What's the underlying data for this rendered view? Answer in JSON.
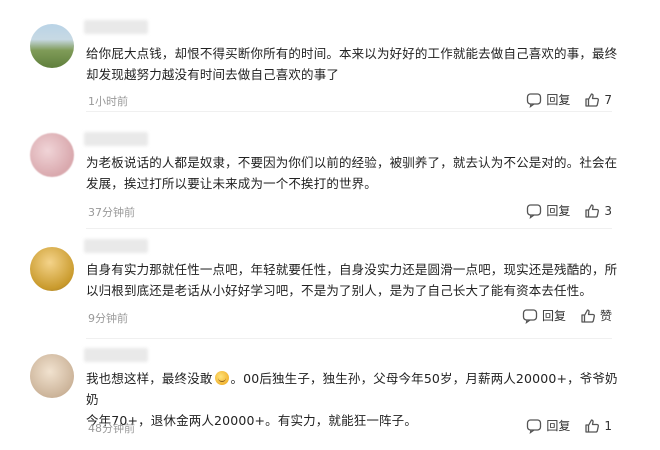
{
  "comments": [
    {
      "text_lines": [
        "给你屁大点钱，却恨不得买断你所有的时间。本来以为好好的工作就能去做自己喜欢的事，最终",
        "却发现越努力越没有时间去做自己喜欢的事了"
      ],
      "time": "1小时前",
      "reply_label": "回复",
      "like_count": "7"
    },
    {
      "text_lines": [
        "为老板说话的人都是奴隶，不要因为你们以前的经验，被驯养了，就去认为不公是对的。社会在",
        "发展，挨过打所以要让未来成为一个不挨打的世界。"
      ],
      "time": "37分钟前",
      "reply_label": "回复",
      "like_count": "3"
    },
    {
      "text_lines": [
        "自身有实力那就任性一点吧，年轻就要任性，自身没实力还是圆滑一点吧，现实还是残酷的，所",
        "以归根到底还是老话从小好好学习吧，不是为了别人，是为了自己长大了能有资本去任性。"
      ],
      "time": "9分钟前",
      "reply_label": "回复",
      "like_count": "赞"
    },
    {
      "text_line1_a": "我也想这样，最终没敢",
      "text_line1_b": "。00后独生子，独生孙，父母今年50岁，月薪两人20000+，爷爷奶奶",
      "text_line2": "今年70+，退休金两人20000+。有实力，就能狂一阵子。",
      "time": "48分钟前",
      "reply_label": "回复",
      "like_count": "1"
    }
  ],
  "icons": {
    "reply": "comment-bubble-icon",
    "like": "thumbs-up-icon",
    "emoji": "face-emoji-icon"
  },
  "colors": {
    "text": "#222222",
    "meta": "#999999",
    "action": "#333333"
  }
}
